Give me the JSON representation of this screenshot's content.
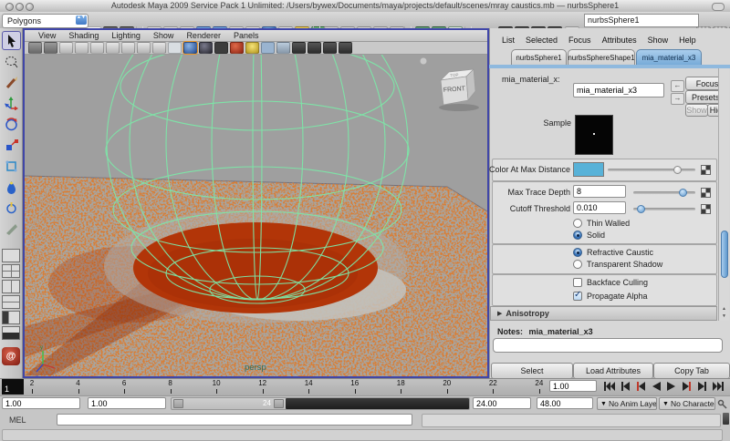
{
  "window": {
    "title": "Autodesk Maya 2009 Service Pack 1 Unlimited:  /Users/bywex/Documents/maya/projects/default/scenes/mray caustics.mb  —  nurbsSphere1"
  },
  "status_line": {
    "menu_set": "Polygons",
    "selection_field": "nurbsSphere1",
    "file_icons": [
      "new-scene",
      "open-scene",
      "save-scene"
    ],
    "mask_icons": [
      "selection-mask-menu",
      "select-by-hierarchy",
      "select-curves",
      "select-surfaces",
      "select-polygons",
      "select-deformations",
      "select-dynamics",
      "select-rendering",
      "select-misc",
      "lock-selection",
      "highlight-selection"
    ],
    "snap_icons": [
      "snap-to-grid",
      "snap-to-curve",
      "snap-to-point",
      "snap-to-projected-center",
      "snap-to-view-plane"
    ],
    "history_icons": [
      "input-connections",
      "output-connections",
      "construction-history"
    ],
    "render_icons": [
      "render-view",
      "render-current-frame",
      "ipr-render",
      "render-settings"
    ],
    "field_menu_icon": "quick-select-menu",
    "panel_toggle_icons": [
      "show-attribute-editor",
      "show-tool-settings",
      "show-channel-box"
    ]
  },
  "toolbox": {
    "tools": [
      "select-tool",
      "lasso-select-tool",
      "paint-select-tool",
      "move-tool",
      "rotate-tool",
      "scale-tool",
      "universal-manipulator-tool",
      "soft-modification-tool",
      "show-manipulator-tool",
      "last-tool-used"
    ],
    "layouts": [
      "single-pane-layout",
      "four-pane-layout",
      "two-pane-side-layout",
      "two-pane-stacked-layout",
      "outliner-persp-layout",
      "hypergraph-persp-layout"
    ],
    "logo": "maya-logo"
  },
  "viewport": {
    "menus": [
      "View",
      "Shading",
      "Lighting",
      "Show",
      "Renderer",
      "Panels"
    ],
    "icons": [
      "camera-attributes",
      "camera-bookmarks",
      "image-plane",
      "view-axis",
      "grid-toggle",
      "film-gate",
      "resolution-gate",
      "gate-mask",
      "safe-display",
      "wireframe-mode",
      "smooth-shade-mode",
      "flat-shade-mode",
      "bounding-box-mode",
      "textured-mode",
      "use-lights",
      "use-shadows",
      "xray-mode",
      "isolate-select",
      "fur-display",
      "hardware-texturing",
      "high-quality-render"
    ],
    "camera_label": "persp",
    "view_cube": {
      "front": "FRONT",
      "top": "TOP"
    },
    "colors": {
      "background": "#9f9f9f",
      "wireframe": "#7de7a8",
      "caustic_disc": "#b23508",
      "photon_speckle": "#b13409"
    }
  },
  "attribute_editor": {
    "menus": [
      "List",
      "Selected",
      "Focus",
      "Attributes",
      "Show",
      "Help"
    ],
    "tabs": [
      {
        "label": "nurbsSphere1"
      },
      {
        "label": "nurbsSphereShape1"
      },
      {
        "label": "mia_material_x3"
      }
    ],
    "active_tab": "mia_material_x3",
    "type_label": "mia_material_x:",
    "node_name": "mia_material_x3",
    "focus_button": "Focus",
    "presets_button": "Presets*",
    "show_button": "Show",
    "hide_button": "Hide",
    "sample_label": "Sample",
    "rows": {
      "color_at_max_distance": {
        "label": "Color At Max Distance",
        "swatch_color": "#58b2d8",
        "slider_pos": 0.79
      },
      "max_trace_depth": {
        "label": "Max Trace Depth",
        "value": "8",
        "slider_pos": 0.8
      },
      "cutoff_threshold": {
        "label": "Cutoff Threshold",
        "value": "0.010",
        "slider_pos": 0.07
      }
    },
    "wall_mode": [
      {
        "label": "Thin Walled",
        "selected": false
      },
      {
        "label": "Solid",
        "selected": true
      }
    ],
    "caustic_mode": [
      {
        "label": "Refractive Caustic",
        "selected": true
      },
      {
        "label": "Transparent Shadow",
        "selected": false
      }
    ],
    "toggles": [
      {
        "label": "Backface Culling",
        "checked": false
      },
      {
        "label": "Propagate Alpha",
        "checked": true
      }
    ],
    "collapsed_section": "Anisotropy",
    "notes_label": "Notes:",
    "notes_value": "mia_material_x3",
    "footer_buttons": [
      "Select",
      "Load Attributes",
      "Copy Tab"
    ],
    "accent_color": "#6ea9dd"
  },
  "timeline": {
    "current_frame": "1",
    "ticks": [
      "2",
      "4",
      "6",
      "8",
      "10",
      "12",
      "14",
      "16",
      "18",
      "20",
      "22",
      "24"
    ],
    "current_time": "1.00",
    "playback_icons": [
      "go-to-start",
      "step-back-frame",
      "step-back-key",
      "play-backwards",
      "play-forwards",
      "step-forward-key",
      "step-forward-frame",
      "go-to-end"
    ]
  },
  "range_slider": {
    "anim_start": "1.00",
    "playback_start": "1.00",
    "playback_end": "24.00",
    "anim_end": "48.00",
    "bar_label": "24",
    "anim_layer": "No Anim Layer",
    "character_set": "No Character Set"
  },
  "command_line": {
    "label": "MEL",
    "input": "",
    "result": ""
  }
}
